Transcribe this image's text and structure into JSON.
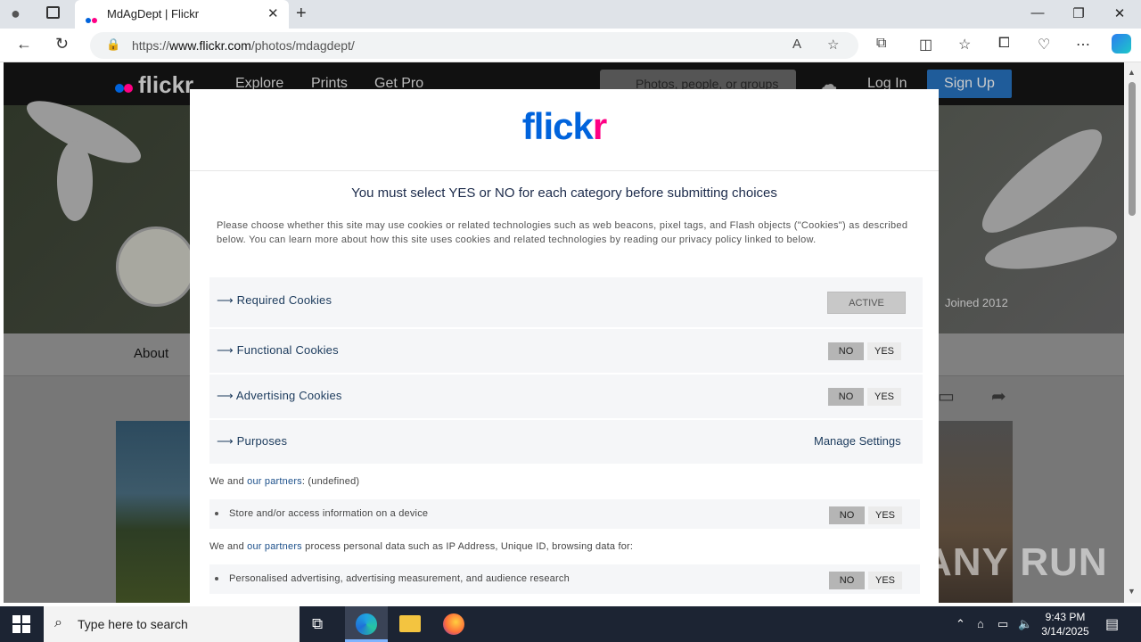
{
  "browser": {
    "tab_title": "MdAgDept | Flickr",
    "url_prefix": "https://",
    "url_domain": "www.flickr.com",
    "url_path": "/photos/mdagdept/"
  },
  "site": {
    "logo": "flickr",
    "nav": [
      "Explore",
      "Prints",
      "Get Pro"
    ],
    "search_placeholder": "Photos, people, or groups",
    "login": "Log In",
    "signup": "Sign Up",
    "joined": "Joined 2012",
    "about_tab": "About"
  },
  "modal": {
    "logo_main": "flick",
    "logo_r": "r",
    "title": "You must select YES or NO for each category before submitting choices",
    "description": "Please choose whether this site may use cookies or related technologies such as web beacons, pixel tags, and Flash objects (\"Cookies\") as described below. You can learn more about how this site uses cookies and related technologies by reading our privacy policy linked to below.",
    "categories": [
      {
        "label": "⟶ Required Cookies",
        "state": "ACTIVE"
      },
      {
        "label": "⟶ Functional Cookies",
        "no": "NO",
        "yes": "YES"
      },
      {
        "label": "⟶ Advertising Cookies",
        "no": "NO",
        "yes": "YES"
      },
      {
        "label": "⟶ Purposes",
        "action": "Manage Settings"
      }
    ],
    "partners_line_1_pre": "We and ",
    "partners_link": "our partners",
    "partners_line_1_post": ": (undefined)",
    "purpose_1": {
      "text": "Store and/or access information on a device",
      "no": "NO",
      "yes": "YES"
    },
    "partners_line_2_post": " process personal data such as IP Address, Unique ID, browsing data for:",
    "purpose_2": {
      "text": "Personalised advertising, advertising measurement, and audience research",
      "no": "NO",
      "yes": "YES"
    }
  },
  "taskbar": {
    "search_placeholder": "Type here to search",
    "time": "9:43 PM",
    "date": "3/14/2025"
  },
  "watermark": "ANY RUN",
  "colors": {
    "flickr_blue": "#0063dc",
    "flickr_pink": "#ff0084",
    "taskbar": "#1c2433"
  }
}
